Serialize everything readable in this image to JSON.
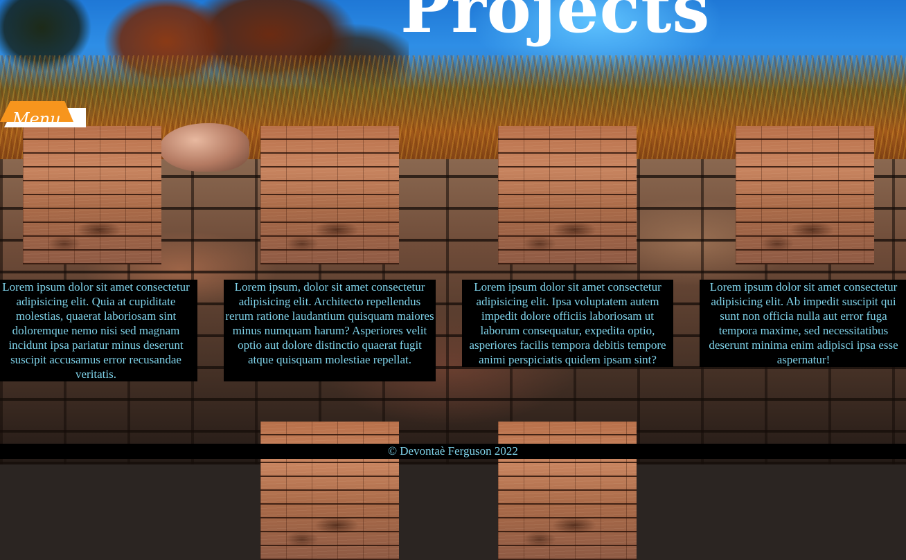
{
  "header": {
    "title": "Projects"
  },
  "menu": {
    "label": "Menu"
  },
  "projects": [
    {
      "description": "Lorem ipsum dolor sit amet consectetur adipisicing elit. Quia at cupiditate molestias, quaerat laboriosam sint doloremque nemo nisi sed magnam incidunt ipsa pariatur minus deserunt suscipit accusamus error recusandae veritatis."
    },
    {
      "description": "Lorem ipsum, dolor sit amet consectetur adipisicing elit. Architecto repellendus rerum ratione laudantium quisquam maiores minus numquam harum? Asperiores velit optio aut dolore distinctio quaerat fugit atque quisquam molestiae repellat."
    },
    {
      "description": "Lorem ipsum dolor sit amet consectetur adipisicing elit. Ipsa voluptatem autem impedit dolore officiis laboriosam ut laborum consequatur, expedita optio, asperiores facilis tempora debitis tempore animi perspiciatis quidem ipsam sint?"
    },
    {
      "description": "Lorem ipsum dolor sit amet consectetur adipisicing elit. Ab impedit suscipit qui sunt non officia nulla aut error fuga tempora maxime, sed necessitatibus deserunt minima enim adipisci ipsa esse aspernatur!"
    }
  ],
  "footer": {
    "text": "© Devontaè Ferguson 2022"
  },
  "colors": {
    "accent": "#f7951d",
    "text": "#7fd3ea",
    "title": "#ffffff"
  }
}
